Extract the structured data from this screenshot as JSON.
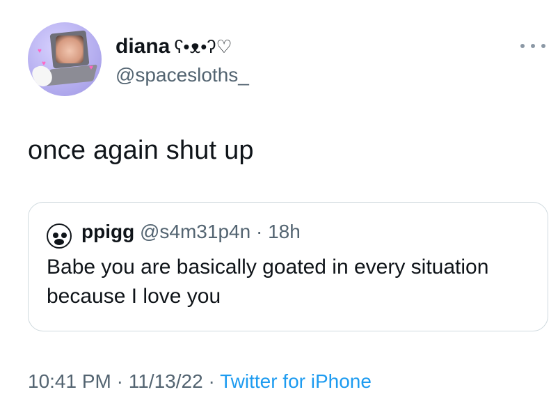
{
  "author": {
    "display_name": "diana",
    "display_name_decoration": "ʕ•ᴥ•ʔ♡",
    "handle": "@spacesloths_",
    "avatar_icon": "laptop-selfie-avatar",
    "more_icon": "ellipsis-icon"
  },
  "tweet": {
    "text": "once again shut up"
  },
  "quoted": {
    "avatar_icon": "pig-avatar-icon",
    "display_name": "ppigg",
    "handle": "@s4m31p4n",
    "separator": "·",
    "time": "18h",
    "text_line1": "Babe you are basically goated in every situation",
    "text_line2": "because I love you"
  },
  "meta": {
    "time": "10:41 PM",
    "sep1": "·",
    "date": "11/13/22",
    "sep2": "·",
    "source": "Twitter for iPhone"
  },
  "colors": {
    "text_primary": "#0f1419",
    "text_secondary": "#536471",
    "link": "#1d9bf0",
    "border": "#cfd9de"
  }
}
